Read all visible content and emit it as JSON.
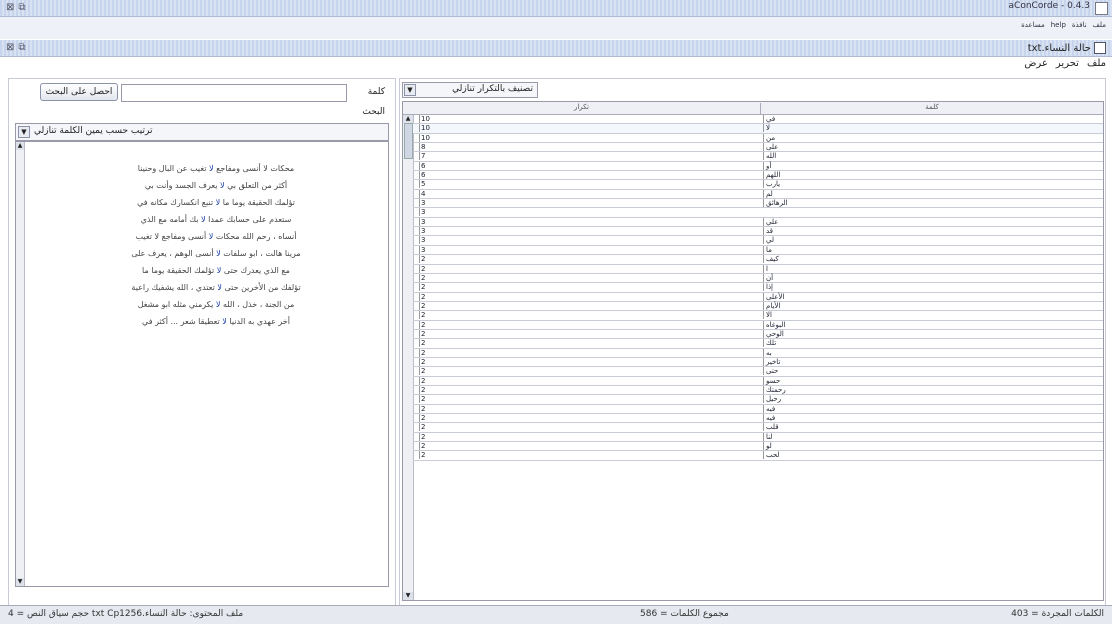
{
  "window": {
    "title": "aConCorde - 0.4.3",
    "app_menu": [
      "ملف",
      "نافذة",
      "help",
      "مساعدة"
    ]
  },
  "inner_window": {
    "checkbox_label": "حالة النساء.txt",
    "menu": [
      "ملف",
      "تحرير",
      "عرض"
    ]
  },
  "search": {
    "label": "كلمة",
    "value": "",
    "button": "احصل على البحث",
    "results_label": "البحث"
  },
  "kwic": {
    "sort_label": "ترتيب حسب يمين الكلمة تنازلي",
    "lines": [
      {
        "right": "محكات لا أنسى ومفاجع",
        "kw": "لا",
        "left": "تغيب عن البال وحنينا"
      },
      {
        "right": "أكثر من التعلق بي",
        "kw": "لا",
        "left": "يعرف الجسد وأنت بي"
      },
      {
        "right": "تؤلمك الحقيقة يوما ما",
        "kw": "لا",
        "left": "تنبع انكسارك مكانه في"
      },
      {
        "right": "ستعدم على حسابك عمدا",
        "kw": "لا",
        "left": "بك أمامه مع الذي"
      },
      {
        "right": "أنساه ، رحم الله محكات",
        "kw": "لا",
        "left": "أنسى ومفاجع لا تغيب"
      },
      {
        "right": "مرينا هالت ، ابو سلفات",
        "kw": "لا",
        "left": "أنسى الوهم ، يعرف على"
      },
      {
        "right": "مع الذي يعدرك حتى",
        "kw": "لا",
        "left": "تؤلمك الحقيقة يوما ما"
      },
      {
        "right": "تؤلفك من الأخرين حتى",
        "kw": "لا",
        "left": "تعتدي ، الله يشفيك راعية"
      },
      {
        "right": "من الجنة ، خذل ، الله",
        "kw": "لا",
        "left": "يكرمني مثله ابو مشغل"
      },
      {
        "right": "أخر عهدي به الدنيا",
        "kw": "لا",
        "left": "تعطيقا شعر ... أكثر في"
      }
    ]
  },
  "frequency": {
    "sort_label": "تصنيف بالتكرار تنازلي",
    "col_freq": "تكرار",
    "col_word": "كلمة",
    "rows": [
      {
        "f": "10",
        "w": "في"
      },
      {
        "f": "10",
        "w": "لا"
      },
      {
        "f": "10",
        "w": "من"
      },
      {
        "f": "8",
        "w": "على"
      },
      {
        "f": "7",
        "w": "الله"
      },
      {
        "f": "6",
        "w": "أو"
      },
      {
        "f": "6",
        "w": "اللهم"
      },
      {
        "f": "5",
        "w": "يارب"
      },
      {
        "f": "4",
        "w": "لم"
      },
      {
        "f": "3",
        "w": "الرهائق"
      },
      {
        "f": "3",
        "w": ""
      },
      {
        "f": "3",
        "w": "علي"
      },
      {
        "f": "3",
        "w": "قد"
      },
      {
        "f": "3",
        "w": "لي"
      },
      {
        "f": "3",
        "w": "ما"
      },
      {
        "f": "2",
        "w": "كيف"
      },
      {
        "f": "2",
        "w": "ا"
      },
      {
        "f": "2",
        "w": "أن"
      },
      {
        "f": "2",
        "w": "إذا"
      },
      {
        "f": "2",
        "w": "الأعلى"
      },
      {
        "f": "2",
        "w": "الأيام"
      },
      {
        "f": "2",
        "w": "الا"
      },
      {
        "f": "2",
        "w": "البوغاه"
      },
      {
        "f": "2",
        "w": "الوحي"
      },
      {
        "f": "2",
        "w": "تلك"
      },
      {
        "f": "2",
        "w": "به"
      },
      {
        "f": "2",
        "w": "تاخير"
      },
      {
        "f": "2",
        "w": "حتى"
      },
      {
        "f": "2",
        "w": "حسو"
      },
      {
        "f": "2",
        "w": "رحمتك"
      },
      {
        "f": "2",
        "w": "رحيل"
      },
      {
        "f": "2",
        "w": "فيه"
      },
      {
        "f": "2",
        "w": "فيه"
      },
      {
        "f": "2",
        "w": "قلب"
      },
      {
        "f": "2",
        "w": "لنا"
      },
      {
        "f": "2",
        "w": "لو"
      },
      {
        "f": "2",
        "w": "لحب"
      }
    ]
  },
  "status": {
    "left": "ملف المحتوى: حالة النساء.txt Cp1256 حجم سياق النص = 4",
    "middle": "مجموع الكلمات = 586",
    "right": "الكلمات المجردة = 403"
  }
}
